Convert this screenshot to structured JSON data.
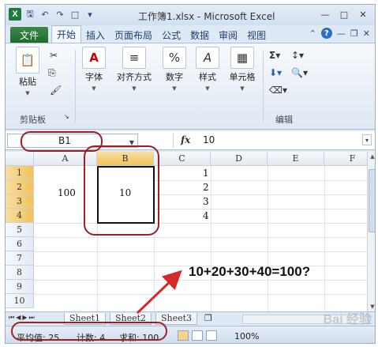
{
  "window": {
    "title": "工作簿1.xlsx - Microsoft Excel"
  },
  "ribbon_tabs": [
    "文件",
    "开始",
    "插入",
    "页面布局",
    "公式",
    "数据",
    "审阅",
    "视图"
  ],
  "ribbon": {
    "paste_label": "粘贴",
    "clipboard_group": "剪贴板",
    "font_label": "字体",
    "alignment_label": "对齐方式",
    "number_label": "数字",
    "styles_label": "样式",
    "cells_label": "单元格",
    "editing_group": "编辑"
  },
  "formula_bar": {
    "name_box": "B1",
    "fx": "fx",
    "value": "10"
  },
  "columns": [
    "A",
    "B",
    "C",
    "D",
    "E",
    "F"
  ],
  "rows": [
    "1",
    "2",
    "3",
    "4",
    "5",
    "6",
    "7",
    "8",
    "9",
    "10"
  ],
  "cells": {
    "a_merged": "100",
    "b_merged": "10",
    "c1": "1",
    "c2": "2",
    "c3": "3",
    "c4": "4"
  },
  "annotation": "10+20+30+40=100?",
  "sheets": [
    "Sheet1",
    "Sheet2",
    "Sheet3"
  ],
  "status": {
    "average": "平均值: 25",
    "count": "计数: 4",
    "sum": "求和: 100",
    "zoom": "100%"
  },
  "watermark": "Bai 经验",
  "colors": {
    "highlight_oval": "#a11e24",
    "arrow": "#d42a2a",
    "selected_header": "#f1c35a"
  }
}
